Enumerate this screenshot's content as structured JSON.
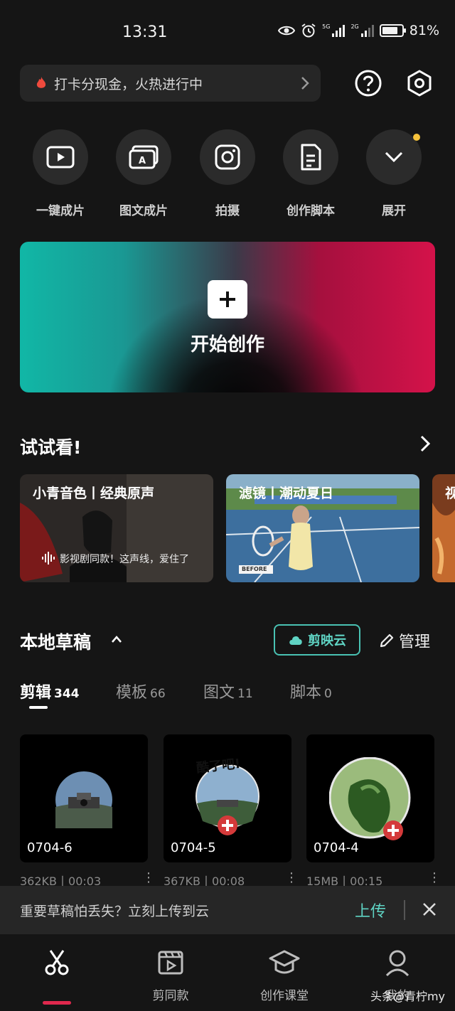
{
  "status": {
    "time": "13:31",
    "battery": "81%",
    "sig1_label": "5G",
    "sig2_label": "2G"
  },
  "promo": {
    "text": "打卡分现金，火热进行中"
  },
  "quick_actions": [
    {
      "label": "一键成片",
      "icon": "play-icon"
    },
    {
      "label": "图文成片",
      "icon": "text-image-icon"
    },
    {
      "label": "拍摄",
      "icon": "camera-icon"
    },
    {
      "label": "创作脚本",
      "icon": "script-icon"
    },
    {
      "label": "展开",
      "icon": "chevron-down-icon"
    }
  ],
  "create": {
    "label": "开始创作"
  },
  "try": {
    "title": "试试看!",
    "cards": [
      {
        "title": "小青音色丨经典原声",
        "caption": "影视剧同款！这声线，爱住了"
      },
      {
        "title": "滤镜丨潮动夏日",
        "badge": "BEFORE"
      },
      {
        "title": "视"
      }
    ]
  },
  "drafts": {
    "title": "本地草稿",
    "cloud_label": "剪映云",
    "manage_label": "管理",
    "tabs": [
      {
        "label": "剪辑",
        "count": "344"
      },
      {
        "label": "模板",
        "count": "66"
      },
      {
        "label": "图文",
        "count": "11"
      },
      {
        "label": "脚本",
        "count": "0"
      }
    ],
    "items": [
      {
        "name": "0704-6",
        "meta": "362KB丨00:03"
      },
      {
        "name": "0704-5",
        "meta": "367KB丨00:08",
        "sticker_text": "酷了吧!"
      },
      {
        "name": "0704-4",
        "meta": "15MB丨00:15"
      }
    ]
  },
  "banner": {
    "text": "重要草稿怕丢失？立刻上传到云",
    "upload_label": "上传"
  },
  "nav": [
    {
      "label": ""
    },
    {
      "label": "剪同款"
    },
    {
      "label": "创作课堂"
    },
    {
      "label": "我的"
    }
  ],
  "watermark": "头条@青柠my",
  "colors": {
    "accent": "#5fd3c3",
    "nav_indicator": "#e0284d",
    "notice_dot": "#f5c23b"
  }
}
